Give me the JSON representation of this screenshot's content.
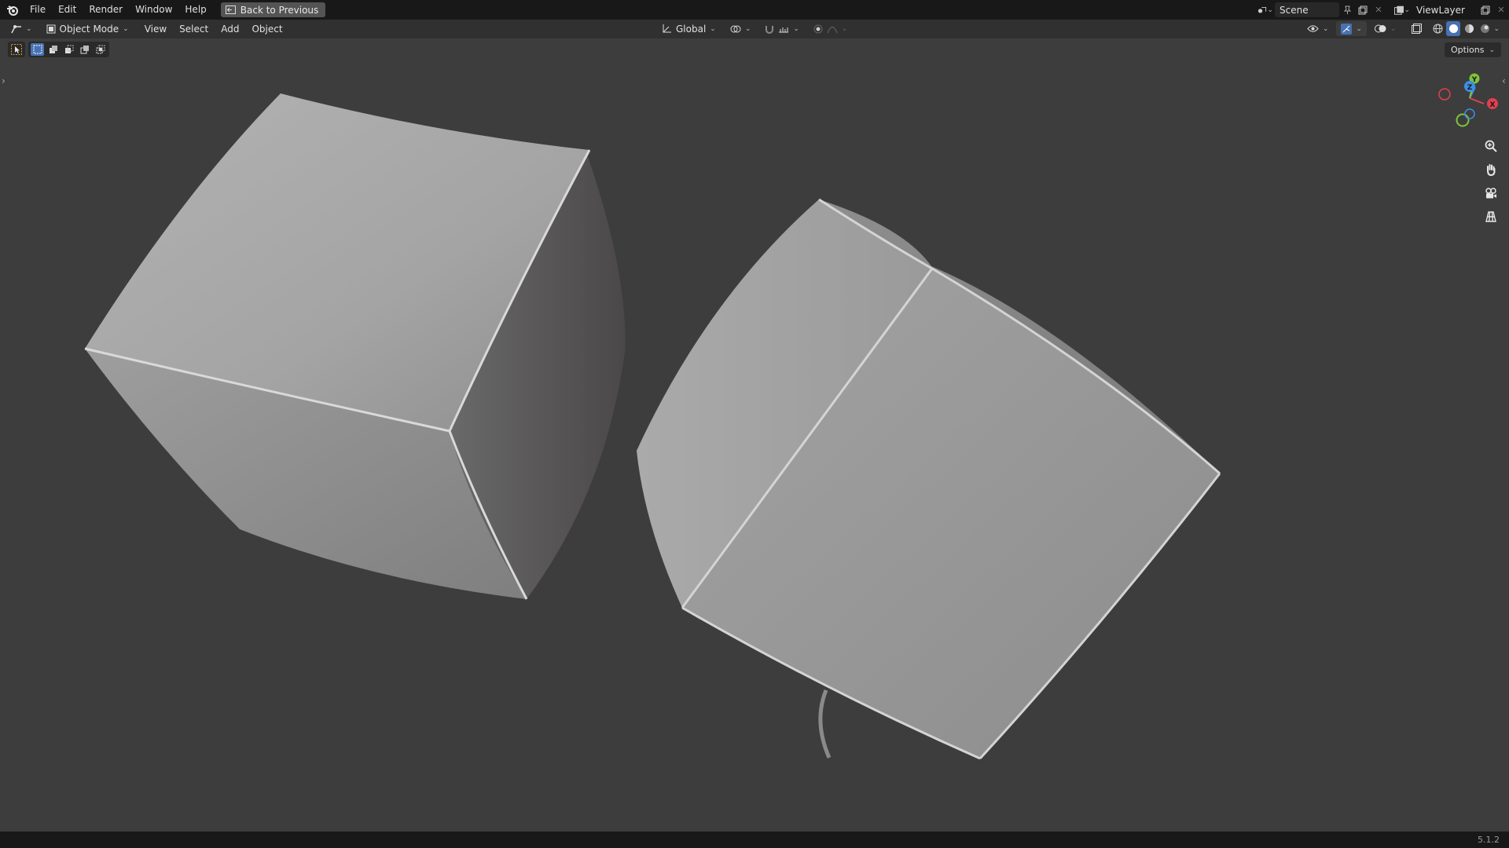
{
  "topbar": {
    "menus": [
      "File",
      "Edit",
      "Render",
      "Window",
      "Help"
    ],
    "back_label": "Back to Previous",
    "scene_name": "Scene",
    "view_layer": "ViewLayer"
  },
  "header": {
    "mode": "Object Mode",
    "menus": [
      "View",
      "Select",
      "Add",
      "Object"
    ],
    "transform_orientation": "Global"
  },
  "toolbar": {
    "options_label": "Options"
  },
  "gizmo": {
    "x_label": "X",
    "y_label": "Y",
    "z_label": "Z",
    "x_color": "#e0404f",
    "y_color": "#7fc43a",
    "z_color": "#3d8fe6"
  },
  "icons": {
    "nav": [
      "zoom-icon",
      "hand-icon",
      "camera-icon",
      "grid-icon"
    ]
  },
  "status": {
    "version": "5.1.2"
  },
  "colors": {
    "accent": "#4772b3",
    "viewport_bg": "#3d3d3d"
  }
}
